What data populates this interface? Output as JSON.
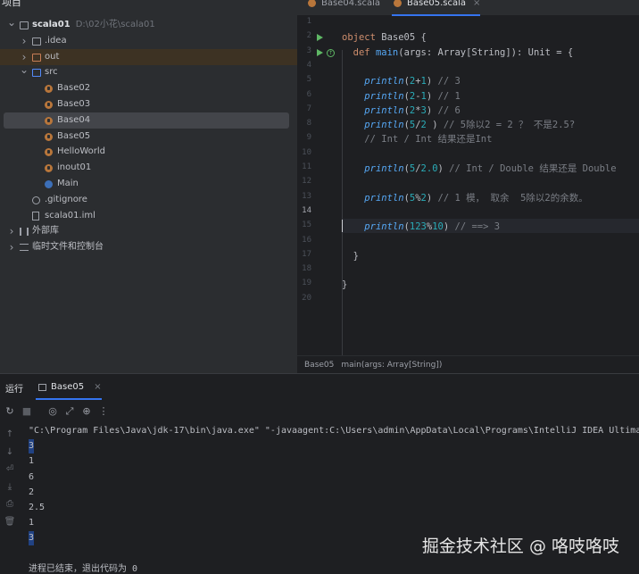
{
  "project": {
    "header": "项目",
    "tree": [
      {
        "label": "scala01",
        "path": "D:\\02小花\\scala01",
        "icon": "folder-icon",
        "chev": "open",
        "indent": 0,
        "bold": true
      },
      {
        "label": ".idea",
        "icon": "folder-icon",
        "chev": "closed",
        "indent": 1
      },
      {
        "label": "out",
        "icon": "folder-orange-icon",
        "chev": "closed",
        "indent": 1,
        "highlight": true
      },
      {
        "label": "src",
        "icon": "folder-blue-icon",
        "chev": "open",
        "indent": 1
      },
      {
        "label": "Base02",
        "icon": "scala-file-icon",
        "indent": 2
      },
      {
        "label": "Base03",
        "icon": "scala-file-icon",
        "indent": 2
      },
      {
        "label": "Base04",
        "icon": "scala-file-icon",
        "indent": 2,
        "selected": true
      },
      {
        "label": "Base05",
        "icon": "scala-file-icon",
        "indent": 2
      },
      {
        "label": "HelloWorld",
        "icon": "scala-file-icon",
        "indent": 2
      },
      {
        "label": "inout01",
        "icon": "scala-file-icon",
        "indent": 2
      },
      {
        "label": "Main",
        "icon": "scala-object-icon",
        "indent": 2
      },
      {
        "label": ".gitignore",
        "icon": "gitignore-icon",
        "indent": 1
      },
      {
        "label": "scala01.iml",
        "icon": "iml-file-icon",
        "indent": 1
      },
      {
        "label": "外部库",
        "icon": "library-icon",
        "chev": "closed",
        "indent": 0
      },
      {
        "label": "临时文件和控制台",
        "icon": "scratch-icon",
        "chev": "closed",
        "indent": 0
      }
    ]
  },
  "editor": {
    "tabs": [
      {
        "label": "Base04.scala",
        "active": false
      },
      {
        "label": "Base05.scala",
        "active": true
      }
    ],
    "close_glyph": "×",
    "line_numbers": [
      "1",
      "2",
      "3",
      "4",
      "5",
      "6",
      "7",
      "8",
      "9",
      "10",
      "11",
      "12",
      "13",
      "14",
      "15",
      "16",
      "17",
      "18",
      "19",
      "20"
    ],
    "current_line": "14",
    "lines": [
      "",
      "object Base05 {",
      "  def main(args: Array[String]): Unit = {",
      "",
      "    println(2+1) // 3",
      "    println(2-1) // 1",
      "    println(2*3) // 6",
      "    println(5/2 ) // 5除以2 = 2 ？ 不是2.5?",
      "    // Int / Int 结果还是Int",
      "",
      "    println(5/2.0) // Int / Double 结果还是 Double",
      "",
      "    println(5%2) // 1 模， 取余  5除以2的余数。",
      "",
      "    println(123%10) // ==> 3",
      "",
      "  }",
      "",
      "}",
      ""
    ],
    "breadcrumb": [
      "Base05",
      "main(args: Array[String])"
    ]
  },
  "run": {
    "title": "运行",
    "tab_label": "Base05",
    "toolbar_icons": [
      "rerun-icon",
      "stop-icon",
      "camera-icon",
      "restore-layout-icon",
      "pin-icon",
      "more-icon"
    ],
    "toolbar_glyphs": [
      "↻",
      "■",
      "◎",
      "⤢",
      "⊕",
      "⋮"
    ],
    "side_icons": [
      "up-arrow-icon",
      "down-arrow-icon",
      "soft-wrap-icon",
      "scroll-to-end-icon",
      "print-icon",
      "trash-icon"
    ],
    "side_glyphs": [
      "↑",
      "↓",
      "⏎",
      "⤓",
      "⎙",
      "🗑"
    ],
    "console": [
      "\"C:\\Program Files\\Java\\jdk-17\\bin\\java.exe\" \"-javaagent:C:\\Users\\admin\\AppData\\Local\\Programs\\IntelliJ IDEA Ultimate",
      "3",
      "1",
      "6",
      "2",
      "2.5",
      "1",
      "3",
      "",
      "进程已结束，退出代码为 0"
    ]
  },
  "watermark": "掘金技术社区 @ 咯吱咯吱"
}
